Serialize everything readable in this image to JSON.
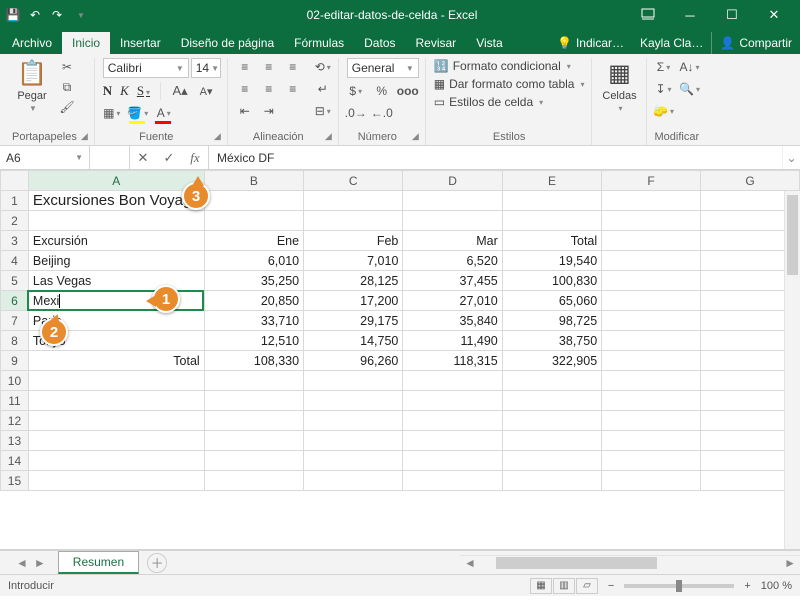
{
  "title": "02-editar-datos-de-celda - Excel",
  "menu": {
    "file": "Archivo",
    "tabs": [
      "Inicio",
      "Insertar",
      "Diseño de página",
      "Fórmulas",
      "Datos",
      "Revisar",
      "Vista"
    ],
    "active": "Inicio",
    "tell": "Indicar…",
    "user": "Kayla Cla…",
    "share": "Compartir"
  },
  "ribbon": {
    "clipboard": {
      "paste": "Pegar",
      "label": "Portapapeles"
    },
    "font": {
      "name": "Calibri",
      "size": "14",
      "bold": "N",
      "italic": "K",
      "underline": "S",
      "label": "Fuente"
    },
    "alignment": {
      "label": "Alineación"
    },
    "number": {
      "format": "General",
      "label": "Número"
    },
    "styles": {
      "cond": "Formato condicional",
      "table": "Dar formato como tabla",
      "cell": "Estilos de celda",
      "label": "Estilos"
    },
    "cells": {
      "label": "Celdas"
    },
    "editing": {
      "label": "Modificar"
    }
  },
  "namebox": "A6",
  "formula": "México DF",
  "cols": [
    "A",
    "B",
    "C",
    "D",
    "E",
    "F",
    "G"
  ],
  "rows": [
    "1",
    "2",
    "3",
    "4",
    "5",
    "6",
    "7",
    "8",
    "9",
    "10",
    "11",
    "12",
    "13",
    "14",
    "15"
  ],
  "cells": {
    "A1": "Excursiones Bon Voyage",
    "A3": "Excursión",
    "B3": "Ene",
    "C3": "Feb",
    "D3": "Mar",
    "E3": "Total",
    "A4": "Beijing",
    "B4": "6,010",
    "C4": "7,010",
    "D4": "6,520",
    "E4": "19,540",
    "A5": "Las Vegas",
    "B5": "35,250",
    "C5": "28,125",
    "D5": "37,455",
    "E5": "100,830",
    "A6": "Mexi",
    "B6": "20,850",
    "C6": "17,200",
    "D6": "27,010",
    "E6": "65,060",
    "A7": "Paris",
    "B7": "33,710",
    "C7": "29,175",
    "D7": "35,840",
    "E7": "98,725",
    "A8": "Tokyo",
    "B8": "12,510",
    "C8": "14,750",
    "D8": "11,490",
    "E8": "38,750",
    "A9": "Total",
    "B9": "108,330",
    "C9": "96,260",
    "D9": "118,315",
    "E9": "322,905"
  },
  "sheet_tab": "Resumen",
  "status": "Introducir",
  "zoom": "100 %",
  "callouts": {
    "c1": "1",
    "c2": "2",
    "c3": "3"
  }
}
